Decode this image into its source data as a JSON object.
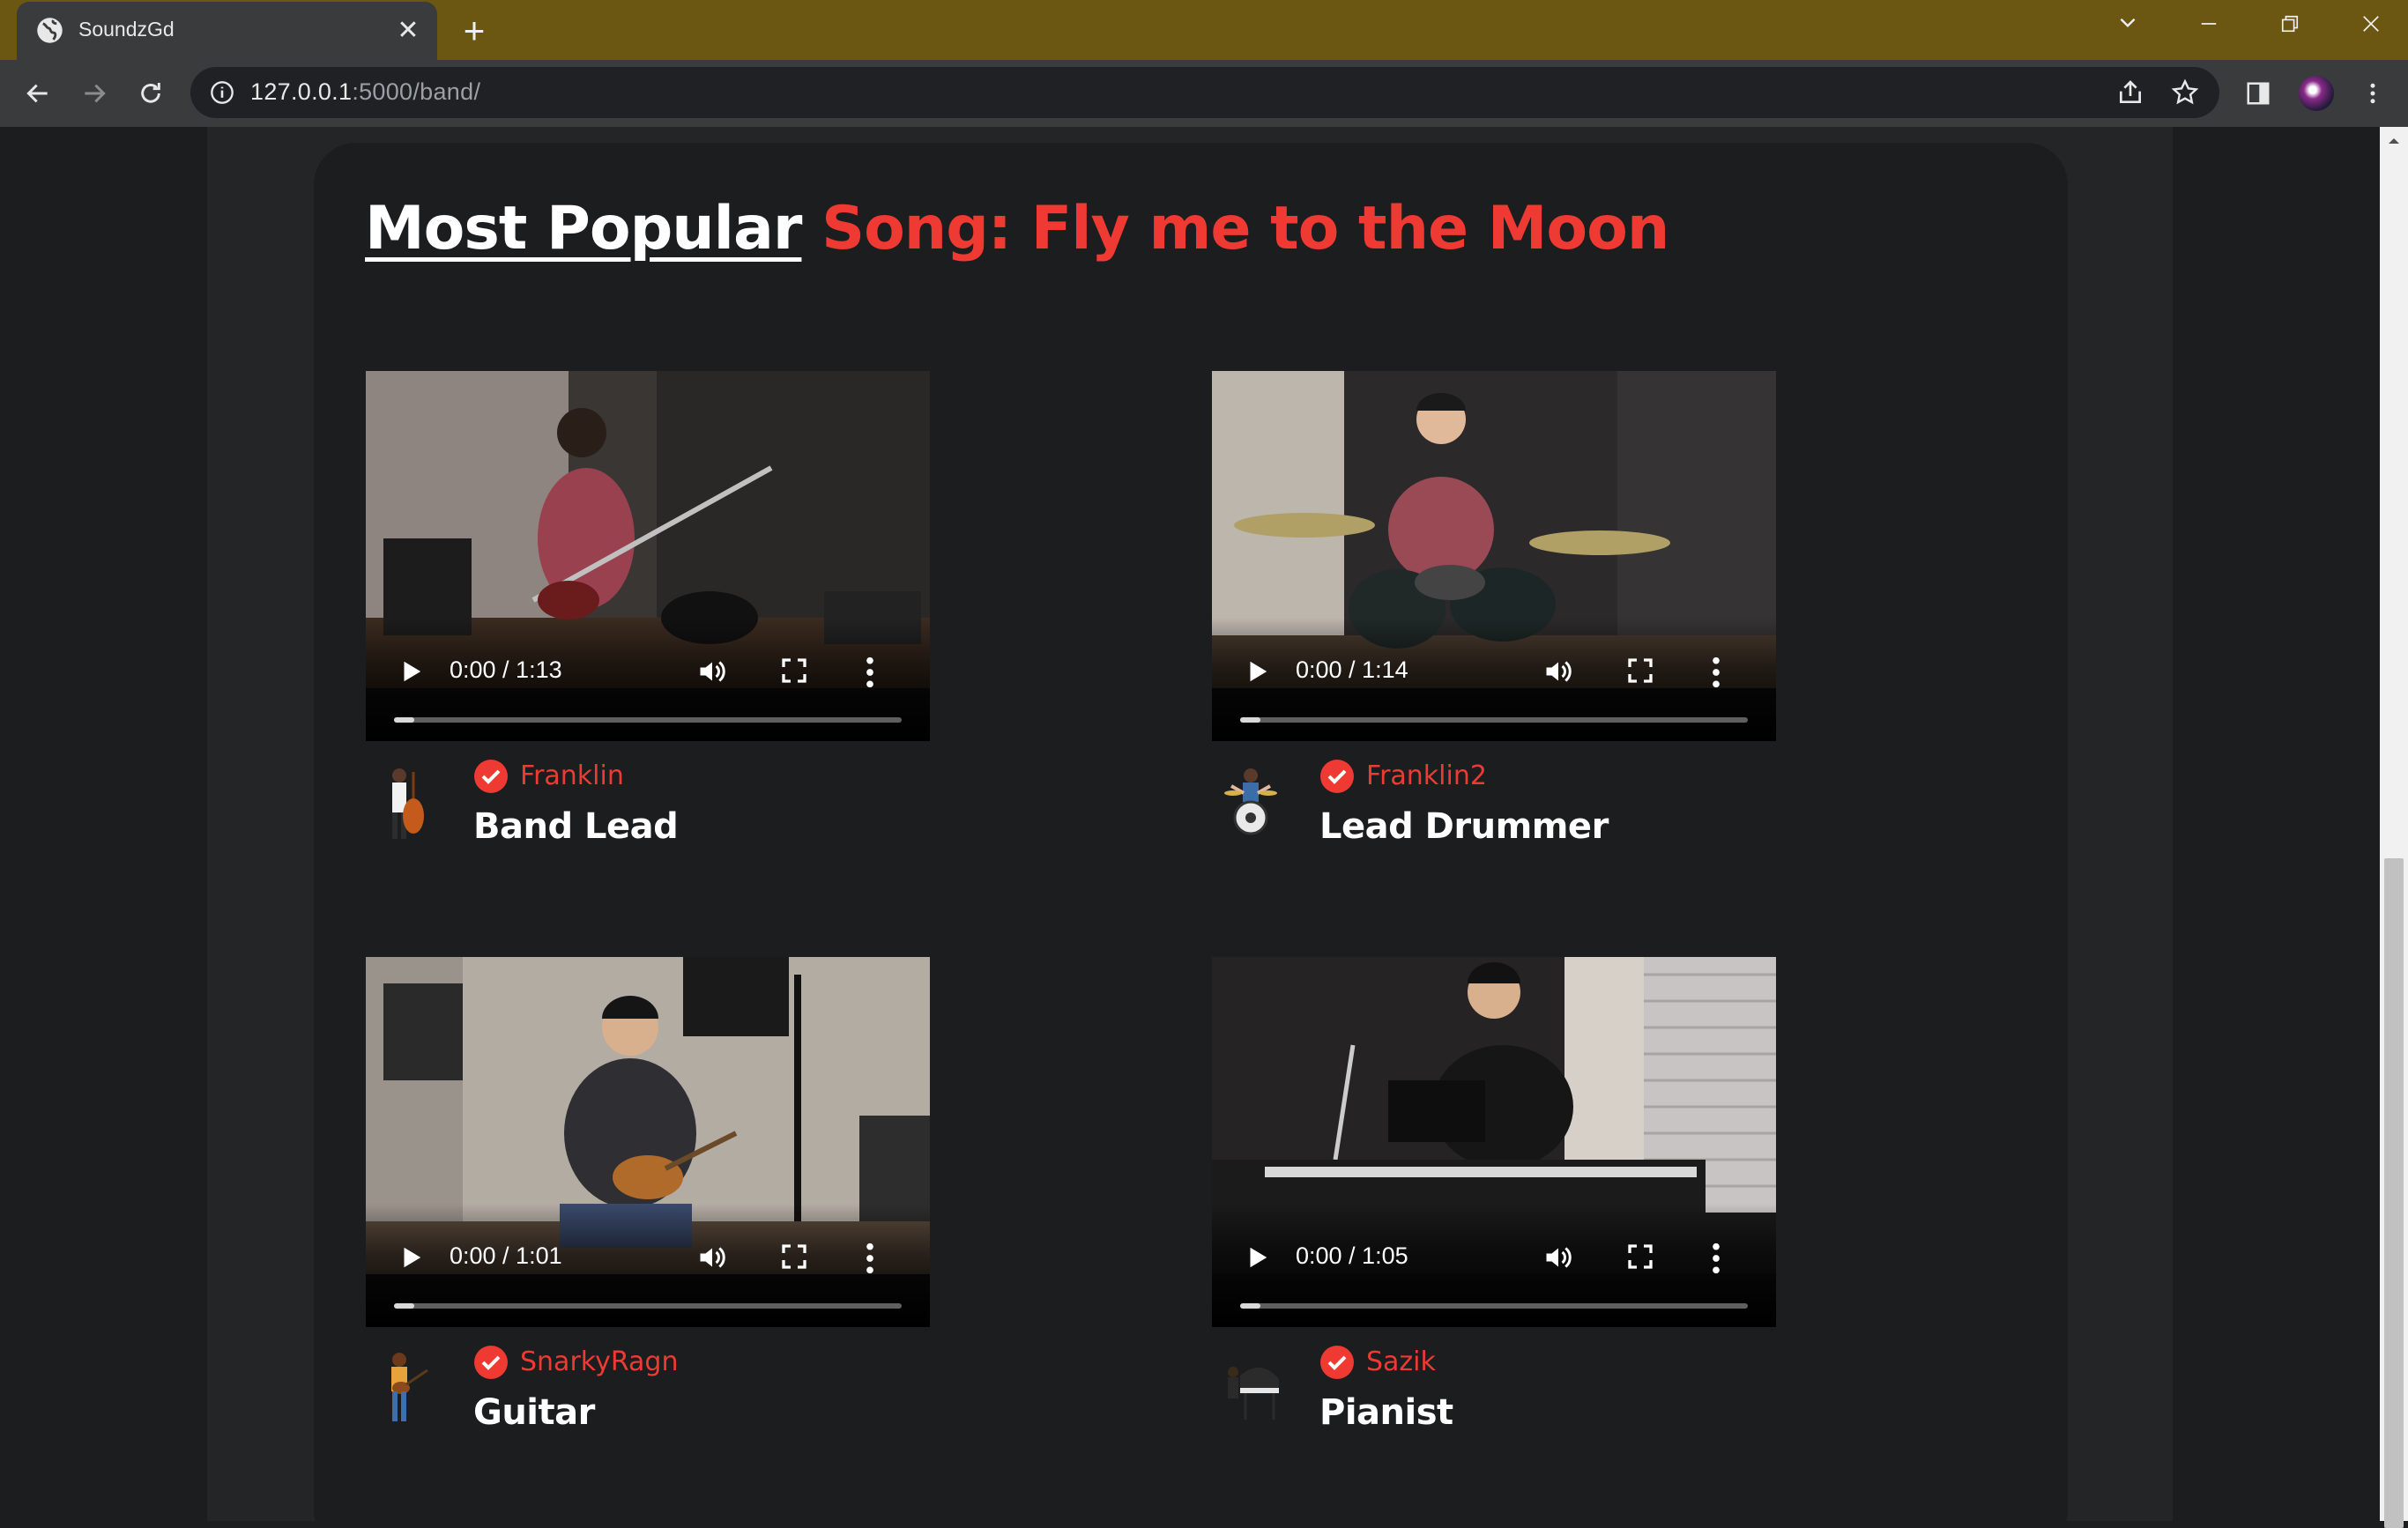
{
  "browser": {
    "tab_title": "SoundzGd",
    "tab_close": "✕",
    "new_tab": "+",
    "url_host": "127.0.0.1",
    "url_path": ":5000/band/",
    "controls": {
      "minimize": "—",
      "restore": "❐",
      "close": "✕",
      "tab_search": "⌄"
    }
  },
  "page": {
    "heading_prefix": "Most Popular",
    "heading_song": "Song: Fly me to the Moon"
  },
  "members": [
    {
      "username": "Franklin",
      "role": "Band Lead",
      "time": "0:00 / 1:13",
      "progress": 0.04,
      "icon": "double-bass-player-icon"
    },
    {
      "username": "Franklin2",
      "role": "Lead Drummer",
      "time": "0:00 / 1:14",
      "progress": 0.04,
      "icon": "drummer-icon"
    },
    {
      "username": "SnarkyRagn",
      "role": "Guitar",
      "time": "0:00 / 1:01",
      "progress": 0.04,
      "icon": "guitarist-icon"
    },
    {
      "username": "Sazik",
      "role": "Pianist",
      "time": "0:00 / 1:05",
      "progress": 0.04,
      "icon": "pianist-icon"
    }
  ],
  "colors": {
    "accent": "#ee3a32",
    "chrome_frame": "#6b5712",
    "page_bg": "#1c1d1f"
  }
}
